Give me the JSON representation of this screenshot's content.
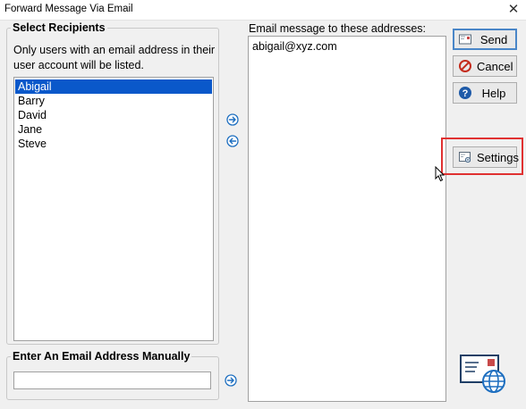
{
  "window": {
    "title": "Forward Message Via Email"
  },
  "recipients": {
    "legend": "Select Recipients",
    "hint": "Only users with an email address in their user account will be listed.",
    "items": [
      "Abigail",
      "Barry",
      "David",
      "Jane",
      "Steve"
    ],
    "selected": "Abigail"
  },
  "email_list": {
    "label": "Email message to these addresses:",
    "addresses": [
      "abigail@xyz.com"
    ]
  },
  "manual": {
    "legend": "Enter An Email Address Manually",
    "value": ""
  },
  "buttons": {
    "send": "Send",
    "cancel": "Cancel",
    "help": "Help",
    "settings": "Settings"
  },
  "colors": {
    "selection": "#0a58ca",
    "accent_blue": "#1e6fc0",
    "cancel_red": "#c42b1c",
    "highlight_box": "#e03131"
  },
  "icons": [
    "close-icon",
    "arrow-right-icon",
    "arrow-left-icon",
    "send-icon",
    "cancel-icon",
    "help-icon",
    "settings-icon",
    "email-globe-icon",
    "mouse-cursor-icon"
  ]
}
